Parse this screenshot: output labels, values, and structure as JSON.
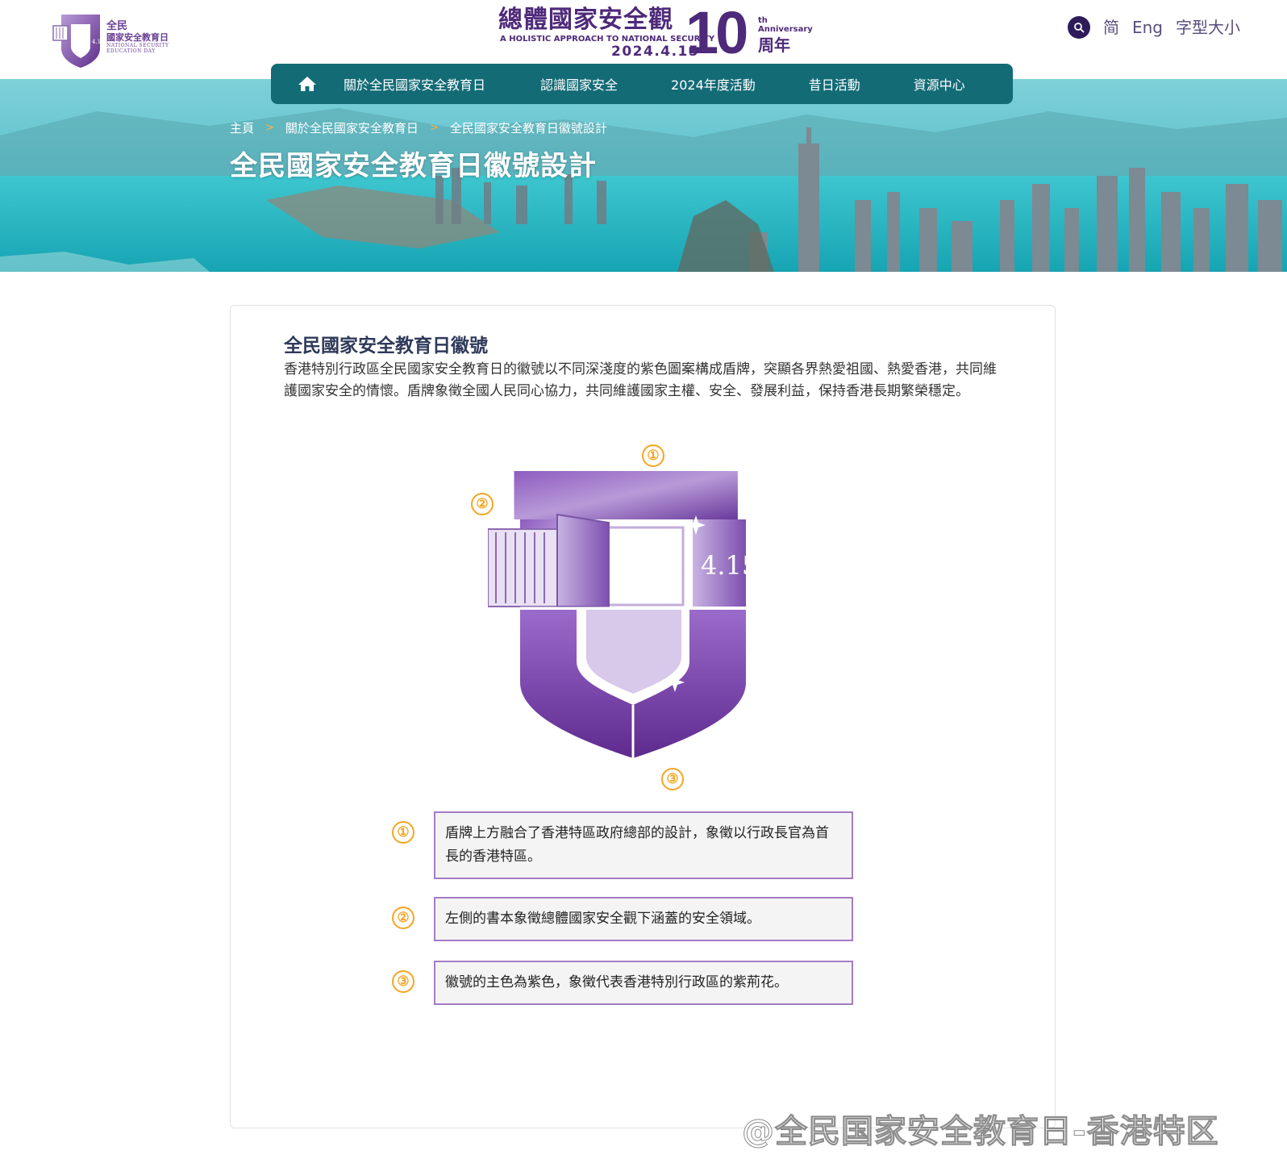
{
  "header": {
    "logo": {
      "line1": "全民",
      "line2": "國家安全教育日",
      "en1": "NATIONAL SECURITY",
      "en2": "EDUCATION DAY",
      "date_mark": "4.15"
    },
    "anniversary": {
      "title": "總體國家安全觀",
      "subtitle_en": "A HOLISTIC APPROACH TO NATIONAL SECURITY",
      "date": "2024.4.15",
      "number": "10",
      "suffix_en_1": "th",
      "suffix_en_2": "Anniversary",
      "suffix_zh": "周年"
    },
    "utility": {
      "search_icon": "search-icon",
      "simplified": "简",
      "english": "Eng",
      "font_size": "字型大小"
    }
  },
  "nav": {
    "home_icon": "home-icon",
    "items": [
      {
        "label": "關於全民國家安全教育日"
      },
      {
        "label": "認識國家安全"
      },
      {
        "label": "2024年度活動"
      },
      {
        "label": "昔日活動"
      },
      {
        "label": "資源中心"
      }
    ]
  },
  "breadcrumb": {
    "items": [
      "主頁",
      "關於全民國家安全教育日",
      "全民國家安全教育日徽號設計"
    ],
    "separator": ">"
  },
  "page_title": "全民國家安全教育日徽號設計",
  "content": {
    "section_title": "全民國家安全教育日徽號",
    "intro": "香港特別行政區全民國家安全教育日的徽號以不同深淺度的紫色圖案構成盾牌，突顯各界熱愛祖國、熱愛香港，共同維護國家安全的情懷。盾牌象徵全國人民同心協力，共同維護國家主權、安全、發展利益，保持香港長期繁榮穩定。",
    "emblem_date": "4.15",
    "markers": [
      "①",
      "②",
      "③"
    ],
    "descriptions": [
      {
        "marker": "①",
        "text": "盾牌上方融合了香港特區政府總部的設計，象徵以行政長官為首長的香港特區。"
      },
      {
        "marker": "②",
        "text": "左側的書本象徵總體國家安全觀下涵蓋的安全領域。"
      },
      {
        "marker": "③",
        "text": "徽號的主色為紫色，象徵代表香港特別行政區的紫荊花。"
      }
    ]
  },
  "watermark": "@全民国家安全教育日-香港特区",
  "colors": {
    "nav_bg": "#136b76",
    "brand_purple": "#6a3f93",
    "marker_orange": "#f5a623",
    "box_border": "#a47cc6",
    "title_navy": "#2f3a5a"
  }
}
